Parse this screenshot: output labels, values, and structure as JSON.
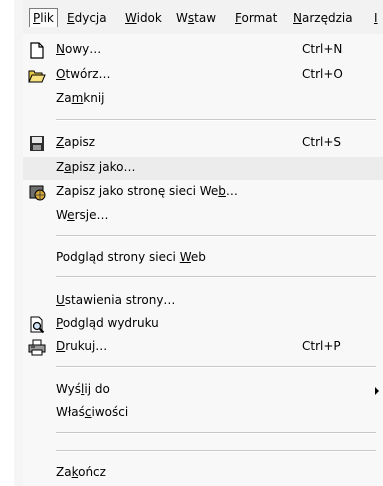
{
  "menubar": {
    "items": [
      {
        "label": "Plik",
        "u": "P",
        "rest": "lik",
        "pre": ""
      },
      {
        "label": "Edycja",
        "pre": "",
        "u": "E",
        "rest": "dycja"
      },
      {
        "label": "Widok",
        "pre": "",
        "u": "W",
        "rest": "idok"
      },
      {
        "label": "Wstaw",
        "pre": "W",
        "u": "s",
        "rest": "taw"
      },
      {
        "label": "Format",
        "pre": "",
        "u": "F",
        "rest": "ormat"
      },
      {
        "label": "Narzędzia",
        "pre": "",
        "u": "N",
        "rest": "arzędzia"
      },
      {
        "label": "I",
        "pre": "",
        "u": "I",
        "rest": ""
      }
    ]
  },
  "menu": {
    "items": [
      {
        "name": "new",
        "pre": "",
        "u": "N",
        "rest": "owy…",
        "shortcut": "Ctrl+N",
        "icon": "new-document-icon"
      },
      {
        "name": "open",
        "pre": "",
        "u": "O",
        "rest": "twórz…",
        "shortcut": "Ctrl+O",
        "icon": "open-folder-icon"
      },
      {
        "name": "close",
        "pre": "Za",
        "u": "m",
        "rest": "knij",
        "shortcut": ""
      },
      {
        "name": "save",
        "pre": "",
        "u": "Z",
        "rest": "apisz",
        "shortcut": "Ctrl+S",
        "icon": "save-disk-icon"
      },
      {
        "name": "save-as",
        "pre": "Z",
        "u": "a",
        "rest": "pisz jako…",
        "shortcut": ""
      },
      {
        "name": "save-as-web",
        "pre": "Zapisz jako stronę sieci We",
        "u": "b",
        "rest": "…",
        "shortcut": "",
        "icon": "web-page-icon"
      },
      {
        "name": "versions",
        "pre": "W",
        "u": "e",
        "rest": "rsje…",
        "shortcut": ""
      },
      {
        "name": "web-preview",
        "pre": "Podgląd strony sieci ",
        "u": "W",
        "rest": "eb",
        "shortcut": ""
      },
      {
        "name": "page-setup",
        "pre": "",
        "u": "U",
        "rest": "stawienia strony…",
        "shortcut": ""
      },
      {
        "name": "print-preview",
        "pre": "",
        "u": "P",
        "rest": "odgląd wydruku",
        "shortcut": "",
        "icon": "print-preview-icon"
      },
      {
        "name": "print",
        "pre": "",
        "u": "D",
        "rest": "rukuj…",
        "shortcut": "Ctrl+P",
        "icon": "printer-icon"
      },
      {
        "name": "send-to",
        "pre": "Wyś",
        "u": "l",
        "rest": "ij do",
        "shortcut": "",
        "submenu": true
      },
      {
        "name": "properties",
        "pre": "Właś",
        "u": "c",
        "rest": "iwości",
        "shortcut": ""
      },
      {
        "name": "exit",
        "pre": "Za",
        "u": "k",
        "rest": "ończ",
        "shortcut": ""
      }
    ]
  }
}
